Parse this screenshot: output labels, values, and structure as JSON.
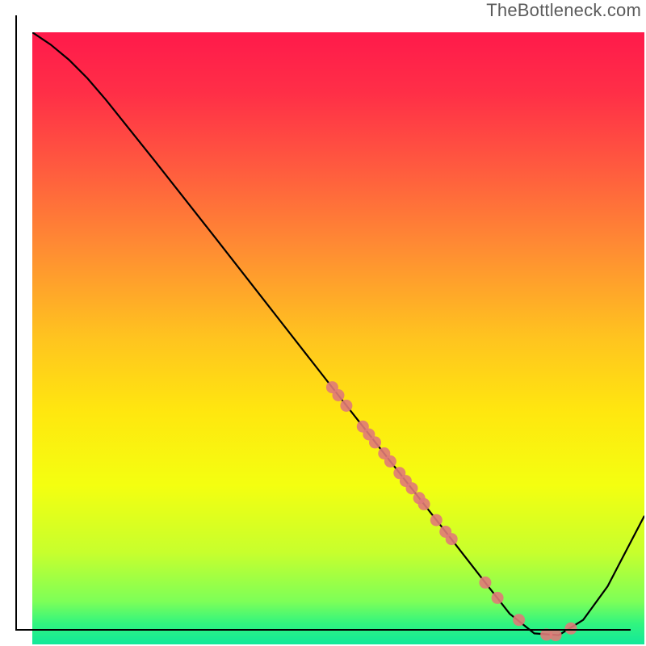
{
  "watermark": "TheBottleneck.com",
  "chart_data": {
    "type": "line",
    "title": "",
    "xlabel": "",
    "ylabel": "",
    "xlim": [
      0,
      100
    ],
    "ylim": [
      0,
      100
    ],
    "grid": false,
    "legend": false,
    "background_gradient": {
      "stops": [
        {
          "offset": 0.0,
          "color": "#ff1a4b"
        },
        {
          "offset": 0.1,
          "color": "#ff2f47"
        },
        {
          "offset": 0.22,
          "color": "#ff5a3f"
        },
        {
          "offset": 0.35,
          "color": "#ff8b33"
        },
        {
          "offset": 0.5,
          "color": "#ffc41f"
        },
        {
          "offset": 0.62,
          "color": "#ffe70f"
        },
        {
          "offset": 0.74,
          "color": "#f4ff10"
        },
        {
          "offset": 0.85,
          "color": "#c7ff2d"
        },
        {
          "offset": 0.93,
          "color": "#7dff58"
        },
        {
          "offset": 0.965,
          "color": "#33f57e"
        },
        {
          "offset": 1.0,
          "color": "#11e89a"
        }
      ]
    },
    "series": [
      {
        "name": "curve",
        "type": "line",
        "color": "#000000",
        "x": [
          0,
          3,
          6,
          9,
          12,
          20,
          30,
          40,
          50,
          60,
          68,
          74,
          78,
          82,
          86,
          90,
          94,
          100
        ],
        "y": [
          100,
          98,
          95.5,
          92.5,
          89,
          79,
          66.3,
          53.5,
          40.7,
          28,
          17.8,
          10.1,
          5,
          1.8,
          1.5,
          4,
          9.5,
          21
        ]
      },
      {
        "name": "markers",
        "type": "scatter",
        "color": "#e07a78",
        "x": [
          49,
          50,
          51.3,
          54,
          55,
          56,
          57.5,
          58.5,
          60,
          61,
          62,
          63.2,
          64,
          66,
          67.5,
          68.5,
          74,
          76,
          79.5,
          84,
          85.5,
          88
        ],
        "y": [
          42,
          40.7,
          39,
          35.6,
          34.3,
          33,
          31.2,
          29.9,
          28,
          26.7,
          25.5,
          23.9,
          22.9,
          20.3,
          18.4,
          17.2,
          10.1,
          7.6,
          4,
          1.6,
          1.5,
          2.6
        ]
      }
    ]
  }
}
